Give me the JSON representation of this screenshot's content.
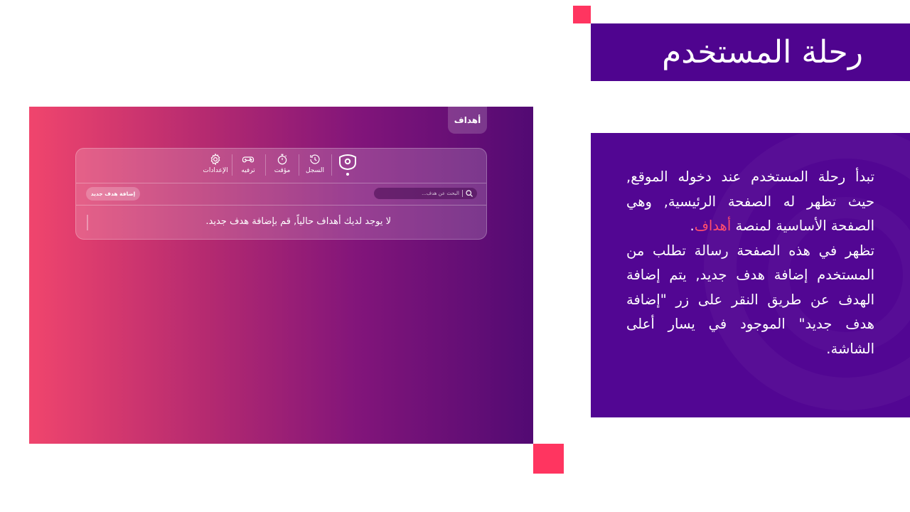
{
  "slide": {
    "title": "رحلة المستخدم",
    "description": {
      "p1_before": "تبدأ رحلة المستخدم عند دخوله الموقع, حيث تظهر له الصفحة الرئيسية, وهي الصفحة الأساسية لمنصة ",
      "p1_highlight": "أهداف",
      "p1_after": ".",
      "p2": "تظهر في هذه الصفحة رسالة تطلب من المستخدم إضافة هدف جديد, يتم إضافة الهدف عن طريق النقر على زر \"إضافة هدف جديد\" الموجود في يسار أعلى الشاشة."
    }
  },
  "app": {
    "brand": "أهداف",
    "nav": [
      {
        "label": "الإعدادات",
        "icon": "gear-icon"
      },
      {
        "label": "ترفيه",
        "icon": "gamepad-icon"
      },
      {
        "label": "مؤقت",
        "icon": "stopwatch-icon"
      },
      {
        "label": "السجل",
        "icon": "history-icon"
      }
    ],
    "home_icon": "target-home-icon",
    "add_goal_label": "إضافة هدف جديد",
    "search_placeholder": "البحث عن هدف...",
    "empty_message": "لا يوجد لديك أهداف حالياً, قم بإضافة هدف جديد."
  },
  "colors": {
    "accent": "#ff3560",
    "title_bg": "#4f048f",
    "text_bg": "#520693",
    "highlight": "#ff4d6d",
    "gradient_start": "#f0456d",
    "gradient_end": "#520a73"
  }
}
